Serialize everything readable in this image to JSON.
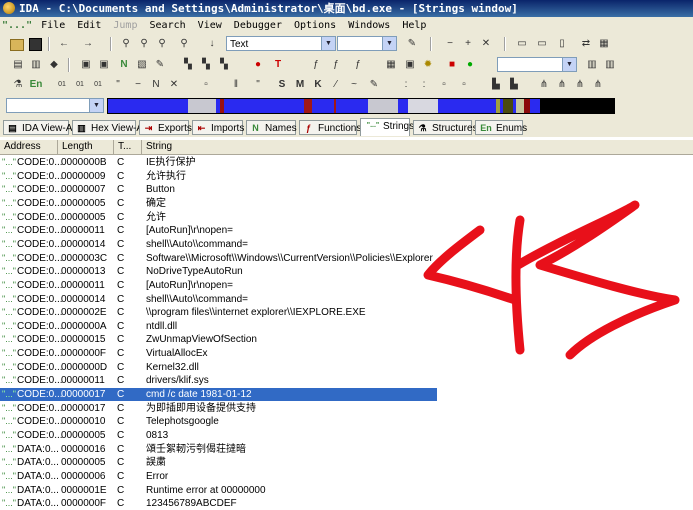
{
  "window": {
    "title": "IDA - C:\\Documents and Settings\\Administrator\\桌面\\bd.exe - [Strings window]"
  },
  "menu": [
    "File",
    "Edit",
    "Jump",
    "Search",
    "View",
    "Debugger",
    "Options",
    "Windows",
    "Help"
  ],
  "toolbar": {
    "text_combo": "Text"
  },
  "tabs": [
    {
      "label": "IDA View-A",
      "icon": "ida-view-icon"
    },
    {
      "label": "Hex View-A",
      "icon": "hex-view-icon"
    },
    {
      "label": "Exports",
      "icon": "exports-icon"
    },
    {
      "label": "Imports",
      "icon": "imports-icon"
    },
    {
      "label": "Names",
      "icon": "names-icon",
      "glyph": "N"
    },
    {
      "label": "Functions",
      "icon": "functions-icon"
    },
    {
      "label": "Strings",
      "icon": "strings-icon",
      "glyph": "\"...\""
    },
    {
      "label": "Structures",
      "icon": "structures-icon"
    },
    {
      "label": "Enums",
      "icon": "enums-icon",
      "glyph": "En"
    }
  ],
  "columns": {
    "address": "Address",
    "length": "Length",
    "type": "T...",
    "string": "String"
  },
  "row_marker": "\"...\"",
  "rows": [
    {
      "address": "CODE:0...",
      "length": "0000000B",
      "type": "C",
      "string": "IE执行保护"
    },
    {
      "address": "CODE:0...",
      "length": "00000009",
      "type": "C",
      "string": "允许执行"
    },
    {
      "address": "CODE:0...",
      "length": "00000007",
      "type": "C",
      "string": "Button"
    },
    {
      "address": "CODE:0...",
      "length": "00000005",
      "type": "C",
      "string": "确定"
    },
    {
      "address": "CODE:0...",
      "length": "00000005",
      "type": "C",
      "string": "允许"
    },
    {
      "address": "CODE:0...",
      "length": "00000011",
      "type": "C",
      "string": "[AutoRun]\\r\\nopen="
    },
    {
      "address": "CODE:0...",
      "length": "00000014",
      "type": "C",
      "string": "shell\\\\Auto\\\\command="
    },
    {
      "address": "CODE:0...",
      "length": "0000003C",
      "type": "C",
      "string": "Software\\\\Microsoft\\\\Windows\\\\CurrentVersion\\\\Policies\\\\Explorer"
    },
    {
      "address": "CODE:0...",
      "length": "00000013",
      "type": "C",
      "string": "NoDriveTypeAutoRun"
    },
    {
      "address": "CODE:0...",
      "length": "00000011",
      "type": "C",
      "string": "[AutoRun]\\r\\nopen="
    },
    {
      "address": "CODE:0...",
      "length": "00000014",
      "type": "C",
      "string": "shell\\\\Auto\\\\command="
    },
    {
      "address": "CODE:0...",
      "length": "0000002E",
      "type": "C",
      "string": "\\\\program files\\\\internet explorer\\\\IEXPLORE.EXE"
    },
    {
      "address": "CODE:0...",
      "length": "0000000A",
      "type": "C",
      "string": "ntdll.dll"
    },
    {
      "address": "CODE:0...",
      "length": "00000015",
      "type": "C",
      "string": "ZwUnmapViewOfSection"
    },
    {
      "address": "CODE:0...",
      "length": "0000000F",
      "type": "C",
      "string": "VirtualAllocEx"
    },
    {
      "address": "CODE:0...",
      "length": "0000000D",
      "type": "C",
      "string": "Kernel32.dll"
    },
    {
      "address": "CODE:0...",
      "length": "00000011",
      "type": "C",
      "string": "drivers/klif.sys"
    },
    {
      "address": "CODE:0...",
      "length": "00000017",
      "type": "C",
      "string": "cmd /c date 1981-01-12",
      "selected": true
    },
    {
      "address": "CODE:0...",
      "length": "00000017",
      "type": "C",
      "string": "为即插即用设备提供支持"
    },
    {
      "address": "CODE:0...",
      "length": "00000010",
      "type": "C",
      "string": "Telephotsgoogle"
    },
    {
      "address": "CODE:0...",
      "length": "00000005",
      "type": "C",
      "string": "0813"
    },
    {
      "address": "DATA:0...",
      "length": "00000016",
      "type": "C",
      "string": "頌壬絮軔污刳偈荘撻暗"
    },
    {
      "address": "DATA:0...",
      "length": "00000005",
      "type": "C",
      "string": "誤粛"
    },
    {
      "address": "DATA:0...",
      "length": "00000006",
      "type": "C",
      "string": "Error"
    },
    {
      "address": "DATA:0...",
      "length": "0000001E",
      "type": "C",
      "string": "Runtime error     at 00000000"
    },
    {
      "address": "DATA:0...",
      "length": "0000000F",
      "type": "C",
      "string": "123456789ABCDEF"
    }
  ],
  "colors": {
    "selection": "#316ac5",
    "annotation": "#e8101a",
    "navband": "#2a2af0"
  }
}
